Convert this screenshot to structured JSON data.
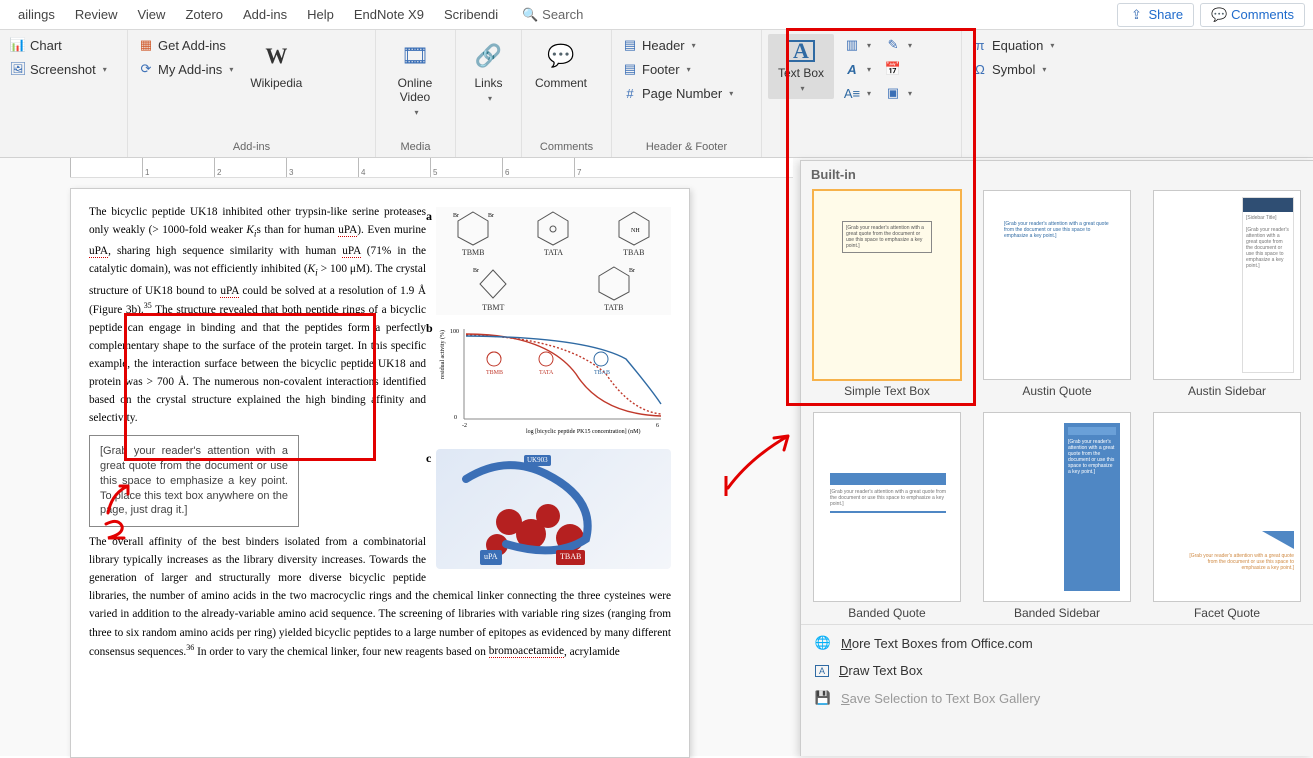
{
  "tabs": {
    "t0": "ailings",
    "t1": "Review",
    "t2": "View",
    "t3": "Zotero",
    "t4": "Add-ins",
    "t5": "Help",
    "t6": "EndNote X9",
    "t7": "Scribendi"
  },
  "search": {
    "placeholder": "Search"
  },
  "share": {
    "label": "Share"
  },
  "comments_btn": {
    "label": "Comments"
  },
  "ribbon": {
    "illus": {
      "chart": "Chart",
      "screenshot": "Screenshot"
    },
    "addins": {
      "get": "Get Add-ins",
      "my": "My Add-ins",
      "wiki": "Wikipedia",
      "group": "Add-ins"
    },
    "media": {
      "video": "Online Video",
      "group": "Media"
    },
    "links": {
      "links": "Links"
    },
    "comments": {
      "comment": "Comment",
      "group": "Comments"
    },
    "hf": {
      "header": "Header",
      "footer": "Footer",
      "pagenum": "Page Number",
      "group": "Header & Footer"
    },
    "text": {
      "textbox": "Text Box"
    },
    "symbols": {
      "equation": "Equation",
      "symbol": "Symbol"
    }
  },
  "gallery": {
    "header": "Built-in",
    "items": {
      "i0": "Simple Text Box",
      "i1": "Austin Quote",
      "i2": "Austin Sidebar",
      "i3": "Banded Quote",
      "i4": "Banded Sidebar",
      "i5": "Facet Quote"
    },
    "thumb_text": "[Grab your reader's attention with a great quote from the document or use this space to emphasize a key point.]",
    "sidebar_title": "[Sidebar Title]",
    "more": "More Text Boxes from Office.com",
    "draw": "Draw Text Box",
    "save": "Save Selection to Text Box Gallery"
  },
  "ruler": {
    "r1": "1",
    "r2": "2",
    "r3": "3",
    "r4": "4",
    "r5": "5",
    "r6": "6",
    "r7": "7"
  },
  "doc": {
    "p1a": "The bicyclic peptide UK18 inhibited other trypsin-like serine proteases only weakly (> 1000-fold weaker ",
    "p1b": "K",
    "p1c": "i",
    "p1d": "s than for human ",
    "p1e": "uPA",
    "p1f": "). Even murine ",
    "p1g": "uPA",
    "p1h": ", sharing high sequence similarity with human ",
    "p1i": "uPA",
    "p1j": " (71% in the catalytic domain), was not efficiently inhibited (",
    "p1k": "K",
    "p1l": "i",
    "p1m": " > 100 μM). The crystal structure of UK18 bound to ",
    "p1n": "uPA",
    "p1o": " could be solved at a resolution of 1.9 Å (Figure 3b).",
    "p1p": "35",
    "p1q": " The structure revealed that both peptide rings of a bicyclic peptide can engage in binding and that the peptides form a perfectly complementary shape to the surface of the protein target. In this specific example, the interaction surface between the bicyclic peptide UK18 and protein was > 700 Å. The numerous non-covalent interactions identified based on the crystal structure explained the high binding affinity and selectivity.",
    "quote": "[Grab your reader's attention with a great quote from the document or use this space to emphasize a key point. To place this text box anywhere on the page, just drag it.]",
    "p2a": "The overall affinity of the best binders isolated from a combinatorial library typically increases as the library diversity increases. Towards the generation of larger and structurally more diverse bicyclic peptide libraries, the number of amino acids in the two macrocyclic rings and the chemical linker connecting the three cysteines were varied in addition to the already-variable amino acid sequence. The screening of libraries with variable ring sizes (ranging from three to six random amino acids per ring) yielded bicyclic peptides to a large number of epitopes as evidenced by many different consensus sequences.",
    "p2b": "36",
    "p2c": " In order to vary the chemical linker, four new reagents based on ",
    "p2d": "bromoacetamide",
    "p2e": ", acrylamide",
    "fig": {
      "a": "a",
      "b": "b",
      "c": "c",
      "m1": "TBMB",
      "m2": "TATA",
      "m3": "TBAB",
      "m4": "TBMT",
      "m5": "TATB",
      "ylab": "residual activity (%)",
      "xlab": "log [bicyclic peptide PK15 concentration] (nM)",
      "uPA": "uPA",
      "tbab": "TBAB",
      "uk": "UK903"
    }
  },
  "chart_data": {
    "type": "line",
    "title": "",
    "xlabel": "log [bicyclic peptide PK15 concentration] (nM)",
    "ylabel": "residual activity (%)",
    "x": [
      -2,
      -1,
      0,
      1,
      2,
      3,
      4,
      5,
      6
    ],
    "ylim": [
      0,
      100
    ],
    "series": [
      {
        "name": "TBMB",
        "color": "#c0392b",
        "values": [
          100,
          99,
          97,
          92,
          70,
          35,
          12,
          5,
          3
        ]
      },
      {
        "name": "TATA",
        "color": "#c0392b",
        "values": [
          100,
          100,
          99,
          98,
          95,
          85,
          55,
          22,
          8
        ]
      },
      {
        "name": "TBAB",
        "color": "#2f6aa3",
        "values": [
          100,
          100,
          100,
          99,
          98,
          96,
          90,
          72,
          40
        ]
      }
    ]
  }
}
